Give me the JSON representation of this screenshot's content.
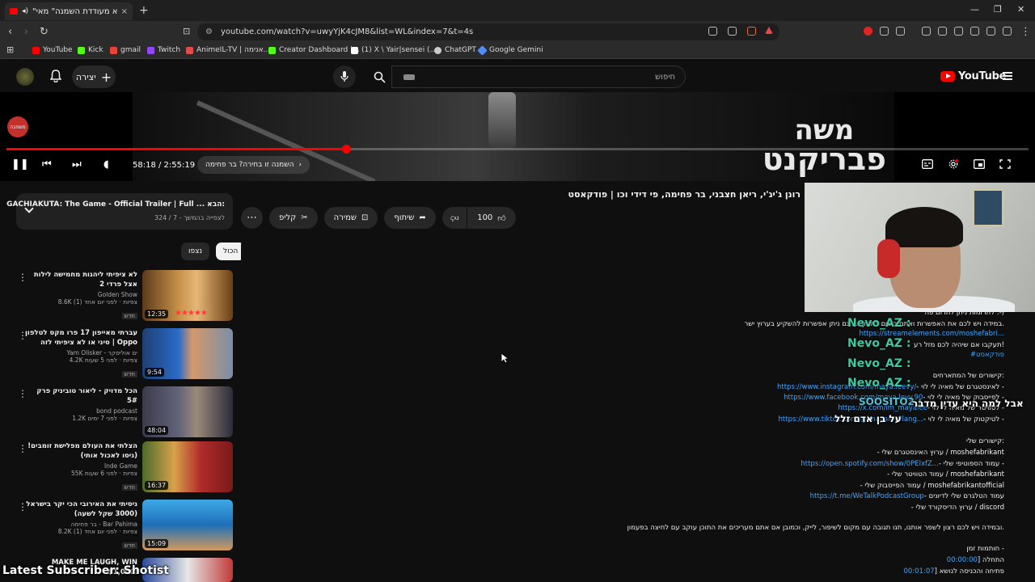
{
  "browser": {
    "tab_title": "\"אני לא מעודדת השמנה\" מאי",
    "url": "youtube.com/watch?v=uwyYjK4cJM8&list=WL&index=7&t=4s",
    "bookmarks": [
      {
        "label": "YouTube",
        "color": "#ff0000"
      },
      {
        "label": "Kick",
        "color": "#53fc18"
      },
      {
        "label": "gmail",
        "color": "#ea4335"
      },
      {
        "label": "Twitch",
        "color": "#9146ff"
      },
      {
        "label": "AnimeIL-TV | אנימה...",
        "color": "#e34b4b"
      },
      {
        "label": "Creator Dashboard |...",
        "color": "#53fc18"
      },
      {
        "label": "(1) X \\ Yair|sensei (...",
        "color": "#ffffff"
      },
      {
        "label": "ChatGPT",
        "color": "#cccccc"
      },
      {
        "label": "Google Gemini",
        "color": "#4f8df5"
      }
    ]
  },
  "header": {
    "create_label": "יצירה",
    "search_placeholder": "חיפוש",
    "logo_text": "YouTube"
  },
  "player": {
    "show_line1": "משה",
    "show_line2": "פבריקנט",
    "badge_text": "משפבה",
    "time_current": "58:18",
    "time_total": "2:55:19",
    "time_display": "58:18 / 2:55:19",
    "chapter_text": "השמנה זו בחירה? בר פחימה",
    "progress_fraction": 0.332
  },
  "video": {
    "title": "רונן ג'יג'י, ריאן חצבני, בר פחימה, פי דידי וכו | פודקאסט",
    "like_count": "100",
    "share_label": "שיתוף",
    "save_label": "שמירה",
    "clip_label": "קליפ"
  },
  "playlist": {
    "title": "GACHIAKUTA: The Game - Official Trailer | Full ... הבא:",
    "subtitle": "לצפייה בהמשך - 7 / 324",
    "chips": [
      "הכול",
      "נצפו"
    ]
  },
  "sidebar": {
    "items": [
      {
        "title": "לא ציפיתי ליהנות מחמישה לילות אצל פרדי 2",
        "channel": "Golden Show",
        "stats": "8.6K צפיות · לפני יום אחד (1)",
        "new": "חדש",
        "duration": "12:35"
      },
      {
        "title": "עברתי מאייפון 17 פרו מקס לטלפון סיני או לא ציפיתי לזה | Oppo Find...",
        "channel": "Yam Olisker - ים אוליסקר",
        "stats": "4.2K צפיות · לפני 5 שעות",
        "new": "חדש",
        "duration": "9:54"
      },
      {
        "title": "הכל מדויק - ליאור טוביניק פרק 5#",
        "channel": "bond podcast",
        "stats": "1.2K צפיות · לפני 7 ימים",
        "new": "",
        "duration": "48:04"
      },
      {
        "title": "הצלתי את העולם מפלישת זומבים! (ניסו לאכול אותי)",
        "channel": "Inde Game",
        "stats": "55K צפיות · לפני 6 שעות",
        "new": "חדש",
        "duration": "16:37"
      },
      {
        "title": "ניסיתי את האירובי הכי יקר בישראל (3000 שקל לשעה)",
        "channel": "בר פחימה - Bar Pahima",
        "stats": "8.2K צפיות · לפני יום אחד (1)",
        "new": "חדש",
        "duration": "15:09"
      },
      {
        "title": "MAKE ME LAUGH, WIN $1,000:",
        "channel": "",
        "stats": "",
        "new": "",
        "duration": ""
      }
    ]
  },
  "description": {
    "lines": [
      {
        "text": "...גוף, בריאות הנפש ופמיניזם.",
        "link": ""
      },
      {
        "text": "לתרומות ניתן לתרום פה :-)",
        "link": ""
      },
      {
        "text": "במידה ויש לכם את האפשרות ואתם רוצים לתמוך ... גם ניתן אפשרות להשקיע בערוץ ישר.",
        "link": ""
      },
      {
        "text": "",
        "link": "https://streamelements.com/moshefabri..."
      },
      {
        "text": "תעקבו אם שיהיה לכם מזל רע!",
        "link": ""
      },
      {
        "text": "",
        "link": "#פודקאסט"
      },
      {
        "text": "קישורים של המתארחים:",
        "link": ""
      },
      {
        "text": "- לאינסטגרם של מאיה לי לוי -",
        "link": "https://www.instagram.com/maya.leevy/"
      },
      {
        "text": "- לפייסבוק של מאיה לי לוי -",
        "link": "https://www.facebook.com/maya.levy.90"
      },
      {
        "text": "- לטוויטר של מאיה לי לוי -",
        "link": "https://x.com/im_mayalee"
      },
      {
        "text": "- לטיקטוק של מאיה לי לוי -",
        "link": "https://www.tiktok.com/@imayalee?lang..."
      },
      {
        "text": "קישורים שלי:",
        "link": ""
      },
      {
        "text": "- ערוץ האינסטגרם שלי / moshefabrikant",
        "link": ""
      },
      {
        "text": "- עמוד הספוטיפי שלי -",
        "link": "https://open.spotify.com/show/0PElxfZ..."
      },
      {
        "text": "- עמוד הטוויטר שלי / moshefabrikant",
        "link": ""
      },
      {
        "text": "- עמוד הפייסבוק שלי / moshefabrikantofficial",
        "link": ""
      },
      {
        "text": "- עמוד הטלגרם שלי לדיונים",
        "link": "https://t.me/WeTalkPodcastGroup"
      },
      {
        "text": "- ערוץ הדיסקורד שלי / discord",
        "link": ""
      },
      {
        "text": "ובמידה ויש לכם רצון לשפר אותנו, תנו תגובה עם מקום לשיפור, לייק, וכמובן אם אתם מעריכים את התוכן עוקב עם לחיצה בפעמון.",
        "link": ""
      },
      {
        "text": "חותמות זמן -",
        "link": ""
      },
      {
        "text": "] התחלה",
        "link": "00:00:00"
      },
      {
        "text": "] פתיחה והכניסה לנושא",
        "link": "00:01:07"
      }
    ]
  },
  "overlay": {
    "chat_user": "Nevo_AZ :",
    "chat_user_2": "SOOSITO2 :",
    "caption_1": "אבל למה היא עדין מדבר",
    "caption_2": "על בן אדם זלל",
    "latest_sub": "Latest Subscriber: Shotist"
  }
}
